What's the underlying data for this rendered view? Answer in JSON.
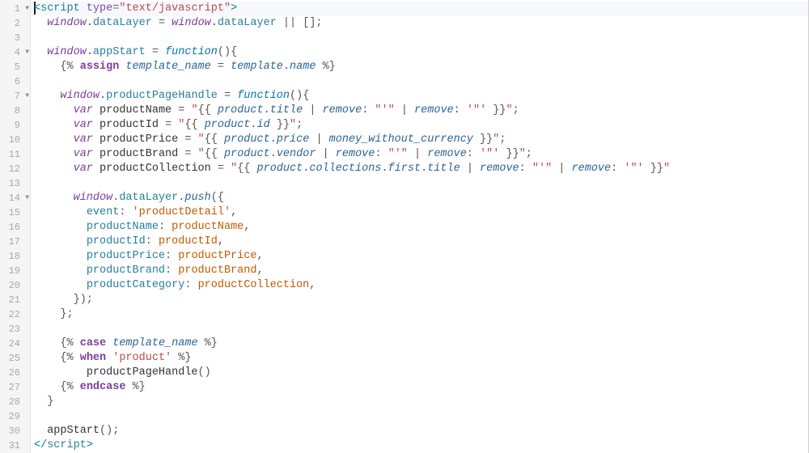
{
  "editor": {
    "lines_count": 31,
    "fold_lines": [
      1,
      4,
      7,
      14
    ],
    "cursor_line": 1,
    "lines": {
      "l1": "<script type=\"text/javascript\">",
      "l2": "  window.dataLayer = window.dataLayer || [];",
      "l3": "",
      "l4": "  window.appStart = function(){",
      "l5": "    {% assign template_name = template.name %}",
      "l6": "",
      "l7": "    window.productPageHandle = function(){",
      "l8": "      var productName = \"{{ product.title | remove: \"'\" | remove: '\"' }}\";",
      "l9": "      var productId = \"{{ product.id }}\";",
      "l10": "      var productPrice = \"{{ product.price | money_without_currency }}\";",
      "l11": "      var productBrand = \"{{ product.vendor | remove: \"'\" | remove: '\"' }}\";",
      "l12": "      var productCollection = \"{{ product.collections.first.title | remove: \"'\" | remove: '\"' }}\"",
      "l13": "",
      "l14": "      window.dataLayer.push({",
      "l15": "        event: 'productDetail',",
      "l16": "        productName: productName,",
      "l17": "        productId: productId,",
      "l18": "        productPrice: productPrice,",
      "l19": "        productBrand: productBrand,",
      "l20": "        productCategory: productCollection,",
      "l21": "      });",
      "l22": "    };",
      "l23": "",
      "l24": "    {% case template_name %}",
      "l25": "    {% when 'product' %}",
      "l26": "        productPageHandle()",
      "l27": "    {% endcase %}",
      "l28": "  }",
      "l29": "",
      "l30": "  appStart();",
      "l31": "</script>"
    },
    "tokens": {
      "script_tag": "script",
      "type_attr": "type",
      "type_val": "\"text/javascript\"",
      "window": "window",
      "dataLayer": "dataLayer",
      "appStart": "appStart",
      "function": "function",
      "assign": "assign",
      "template_name": "template_name",
      "template": "template",
      "name": "name",
      "productPageHandle": "productPageHandle",
      "var": "var",
      "productName": "productName",
      "productId": "productId",
      "productPrice": "productPrice",
      "productBrand": "productBrand",
      "productCollection": "productCollection",
      "product": "product",
      "title": "title",
      "id": "id",
      "price": "price",
      "vendor": "vendor",
      "collections": "collections",
      "first": "first",
      "remove": "remove",
      "money_without_currency": "money_without_currency",
      "push": "push",
      "event": "event",
      "productDetail": "'productDetail'",
      "productCategory": "productCategory",
      "case": "case",
      "when": "when",
      "product_str": "'product'",
      "endcase": "endcase",
      "sq": "\"'\"",
      "dq": "'\"'"
    }
  }
}
